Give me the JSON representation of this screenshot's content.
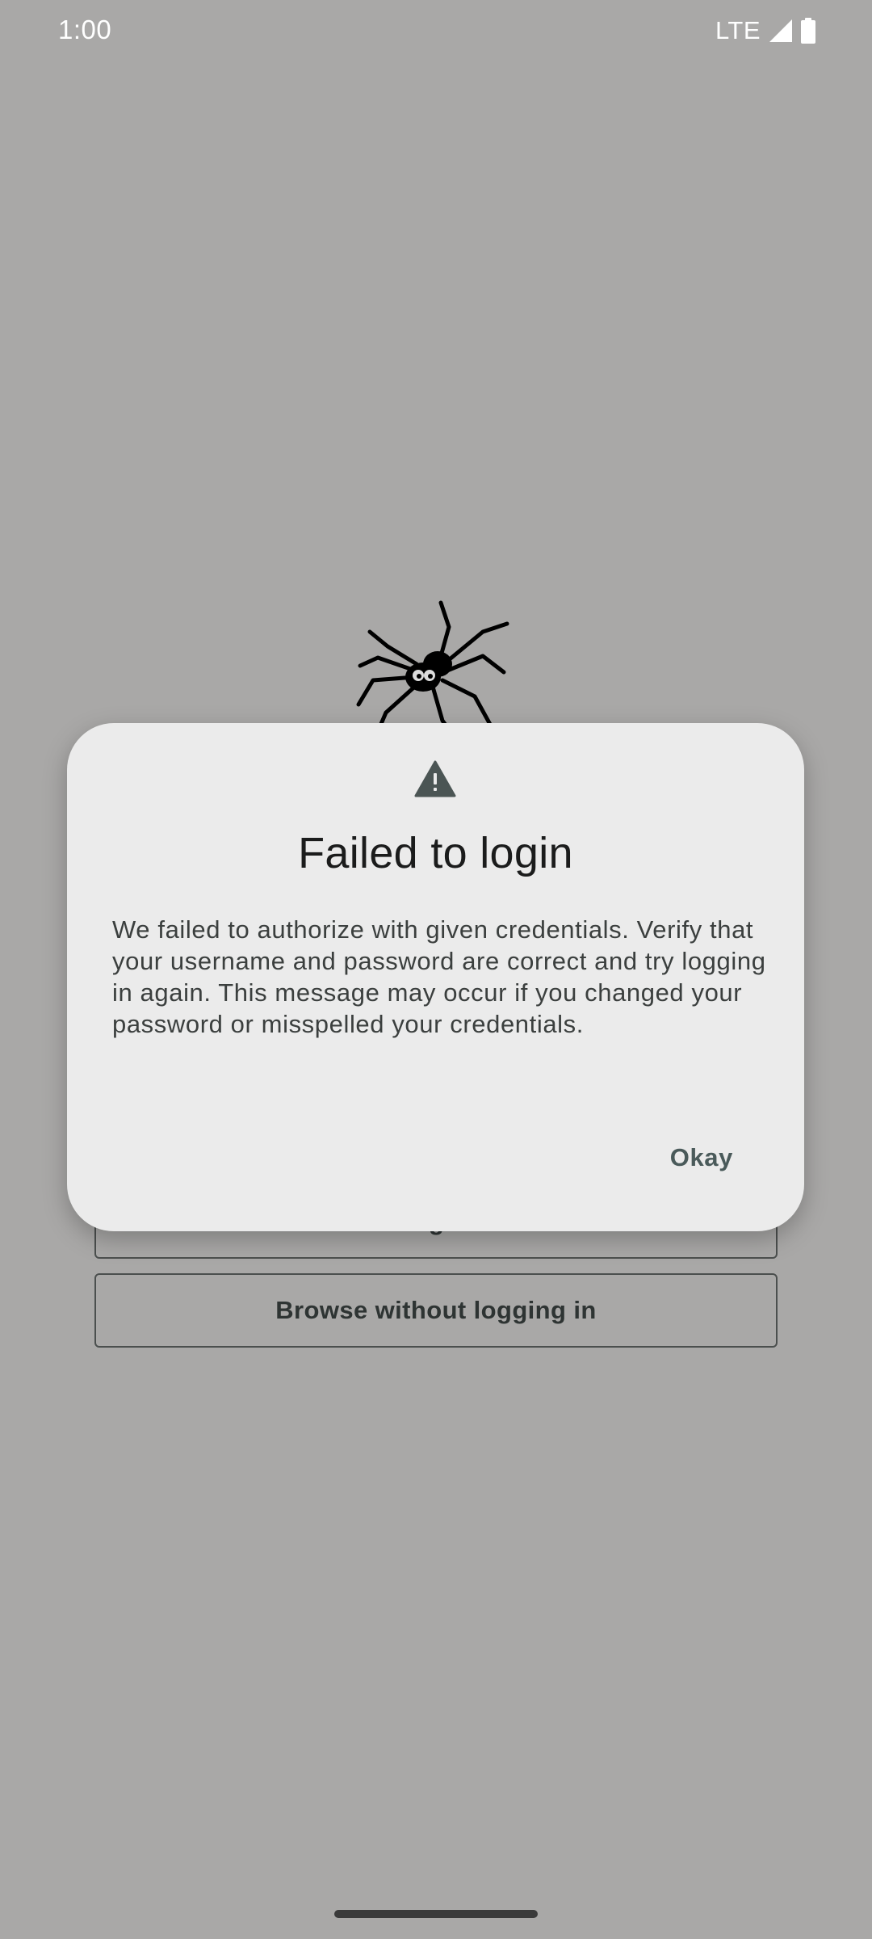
{
  "status_bar": {
    "time": "1:00",
    "network": "LTE",
    "signal_icon": "cell-signal-icon",
    "battery_icon": "battery-icon"
  },
  "background": {
    "logo_icon": "spider-logo",
    "login_button_label": "Log in",
    "browse_button_label": "Browse without logging in"
  },
  "dialog": {
    "icon": "warning-icon",
    "title": "Failed to login",
    "message": "We failed to authorize with given credentials. Verify that your username and password are correct and try logging in again. This message may occur if you changed your password or misspelled your credentials.",
    "okay_label": "Okay"
  },
  "colors": {
    "scrim_background": "#a9a8a7",
    "dialog_surface": "#ebebeb",
    "accent_text": "#4a5a5a"
  }
}
